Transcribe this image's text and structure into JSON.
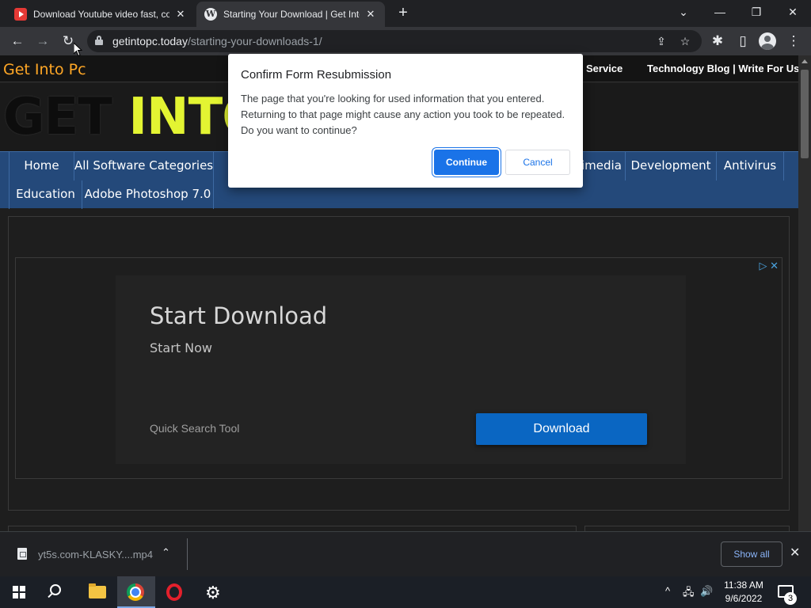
{
  "browser": {
    "tabs": [
      {
        "title": "Download Youtube video fast, co",
        "favicon": "youtube-icon"
      },
      {
        "title": "Starting Your Download | Get Into",
        "favicon": "wordpress-icon"
      }
    ],
    "url_domain": "getintopc.today",
    "url_path": "/starting-your-downloads-1/"
  },
  "site": {
    "name": "Get Into Pc",
    "toplink_service": "Service",
    "toplink_blog": "Technology Blog | Write For Us",
    "logo_part1": "GET",
    "logo_part2": "INTO",
    "nav": [
      "Home",
      "All Software Categories",
      "imedia",
      "Development",
      "Antivirus",
      "Education",
      "Adobe Photoshop 7.0"
    ]
  },
  "ad": {
    "title": "Start Download",
    "subtitle": "Start Now",
    "tool": "Quick Search Tool",
    "button": "Download"
  },
  "dialog": {
    "title": "Confirm Form Resubmission",
    "line1": "The page that you're looking for used information that you entered.",
    "line2": "Returning to that page might cause any action you took to be repeated.",
    "line3": "Do you want to continue?",
    "continue": "Continue",
    "cancel": "Cancel"
  },
  "downloads": {
    "file": "yt5s.com-KLASKY....mp4",
    "show_all": "Show all"
  },
  "taskbar": {
    "time": "11:38 AM",
    "date": "9/6/2022",
    "notifications": "3"
  },
  "colors": {
    "site_name": "#ffa726",
    "logo_accent": "#e3f432",
    "nav_bg": "#24497a",
    "primary_button": "#1a73e8",
    "ad_button": "#0a66c2"
  }
}
